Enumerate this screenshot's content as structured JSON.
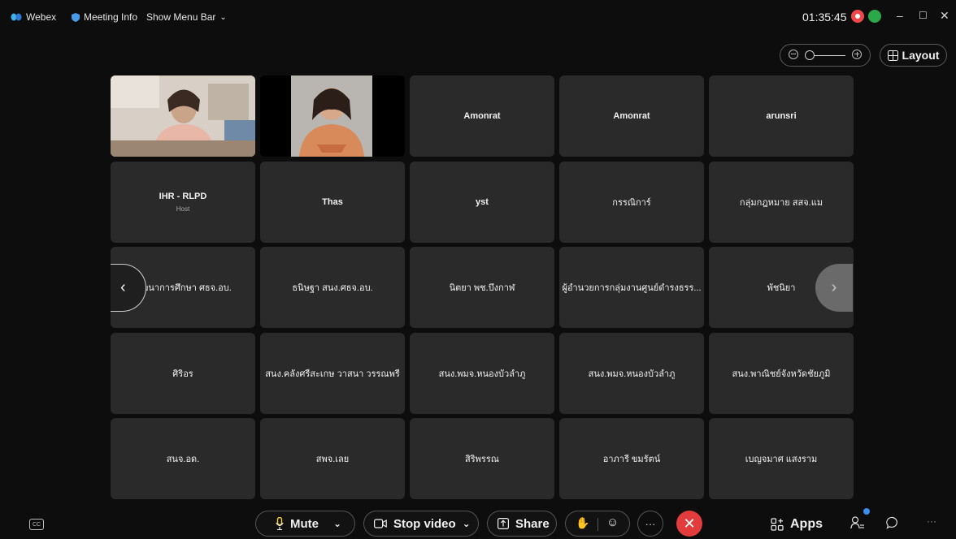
{
  "titlebar": {
    "app_name": "Webex",
    "meeting_info": "Meeting Info",
    "show_menu_bar": "Show Menu Bar",
    "clock": "01:35:45"
  },
  "view": {
    "layout_label": "Layout"
  },
  "participants": [
    {
      "name": "",
      "video": true
    },
    {
      "name": "",
      "video": true
    },
    {
      "name": "Amonrat"
    },
    {
      "name": "Amonrat"
    },
    {
      "name": "arunsri"
    },
    {
      "name": "IHR - RLPD",
      "role": "Host"
    },
    {
      "name": "Thas"
    },
    {
      "name": "yst"
    },
    {
      "name": "กรรณิการ์"
    },
    {
      "name": "กลุ่มกฎหมาย สสจ.แม"
    },
    {
      "name": "พัฒนาการศึกษา ศธจ.อบ."
    },
    {
      "name": "ธนิษฐา สนง.ศธจ.อบ."
    },
    {
      "name": "นิตยา พช.บึงกาฬ"
    },
    {
      "name": "ผู้อำนวยการกลุ่มงานศูนย์ดำรงธรร..."
    },
    {
      "name": "พัชนิยา"
    },
    {
      "name": "ศิริอร"
    },
    {
      "name": "สนง.คลังศรีสะเกษ วาสนา วรรณพรี"
    },
    {
      "name": "สนง.พมจ.หนองบัวลำภู"
    },
    {
      "name": "สนง.พมจ.หนองบัวลำภู"
    },
    {
      "name": "สนง.พาณิชย์จังหวัดชัยภูมิ"
    },
    {
      "name": "สนจ.อด."
    },
    {
      "name": "สพจ.เลย"
    },
    {
      "name": "สิริพรรณ"
    },
    {
      "name": "อาภารี ขมรัตน์"
    },
    {
      "name": "เบญจมาศ แสงราม"
    }
  ],
  "controls": {
    "mute": "Mute",
    "stop_video": "Stop video",
    "share": "Share",
    "apps": "Apps",
    "more": "···"
  },
  "colors": {
    "end_call": "#e23c3c",
    "recording": "#f0484a",
    "network": "#2ba84a",
    "notify": "#3b8df0"
  }
}
